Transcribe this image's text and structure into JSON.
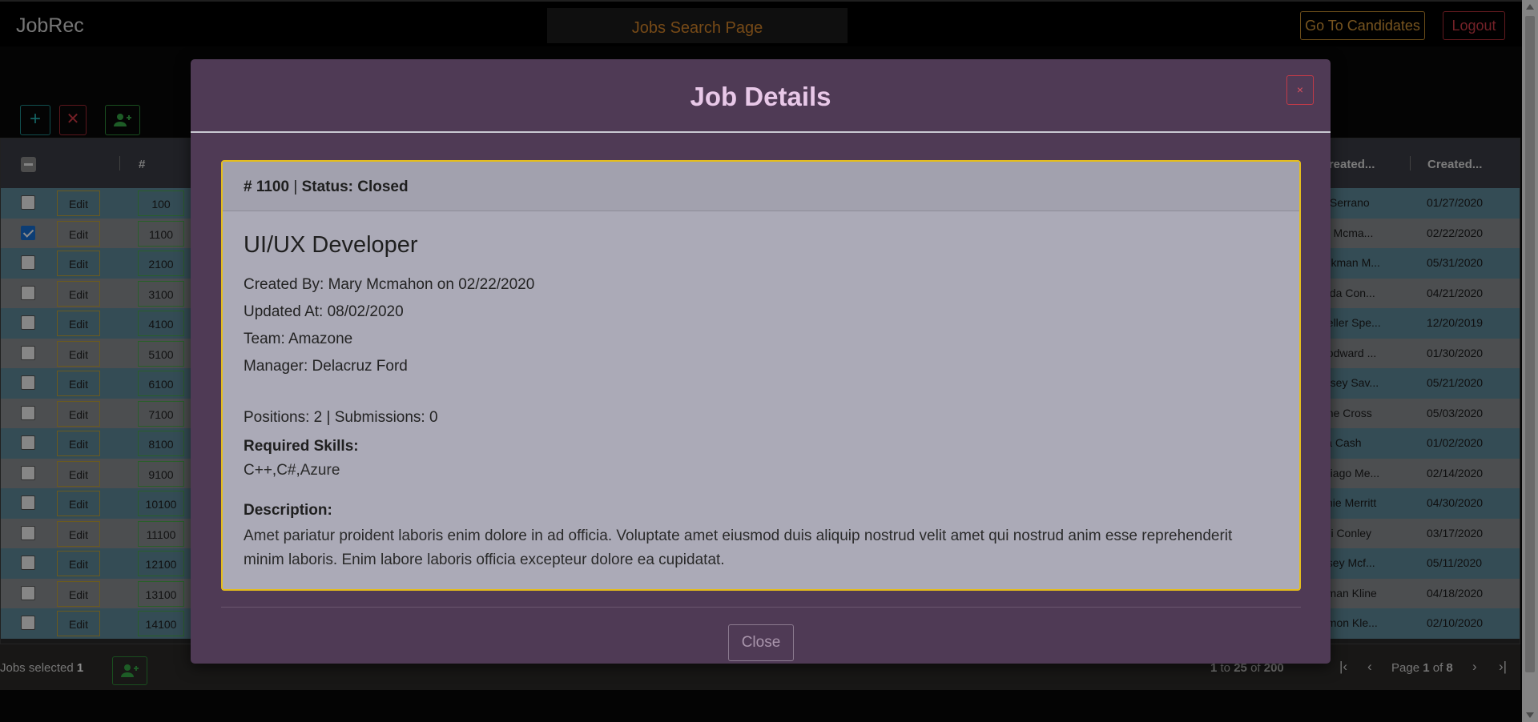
{
  "navbar": {
    "brand": "JobRec",
    "page_title": "Jobs Search Page",
    "go_to_candidates": "Go To Candidates",
    "logout": "Logout"
  },
  "toolbar": {
    "add_icon": "+",
    "delete_icon": "✕",
    "assign_icon": "person-add-icon"
  },
  "grid": {
    "headers": {
      "number": "#",
      "created_by": "Created...",
      "created_on": "Created..."
    },
    "rows": [
      {
        "checked": false,
        "edit": "Edit",
        "id": "100",
        "created_by": "s Serrano",
        "created_on": "01/27/2020"
      },
      {
        "checked": true,
        "edit": "Edit",
        "id": "1100",
        "created_by": "ry Mcma...",
        "created_on": "02/22/2020"
      },
      {
        "checked": false,
        "edit": "Edit",
        "id": "2100",
        "created_by": "orkman M...",
        "created_on": "05/31/2020"
      },
      {
        "checked": false,
        "edit": "Edit",
        "id": "3100",
        "created_by": "inda Con...",
        "created_on": "04/21/2020"
      },
      {
        "checked": false,
        "edit": "Edit",
        "id": "4100",
        "created_by": "heller Spe...",
        "created_on": "12/20/2019"
      },
      {
        "checked": false,
        "edit": "Edit",
        "id": "5100",
        "created_by": "oodward ...",
        "created_on": "01/30/2020"
      },
      {
        "checked": false,
        "edit": "Edit",
        "id": "6100",
        "created_by": "msey Sav...",
        "created_on": "05/21/2020"
      },
      {
        "checked": false,
        "edit": "Edit",
        "id": "7100",
        "created_by": "one Cross",
        "created_on": "05/03/2020"
      },
      {
        "checked": false,
        "edit": "Edit",
        "id": "8100",
        "created_by": "lia Cash",
        "created_on": "01/02/2020"
      },
      {
        "checked": false,
        "edit": "Edit",
        "id": "9100",
        "created_by": "ntiago Me...",
        "created_on": "02/14/2020"
      },
      {
        "checked": false,
        "edit": "Edit",
        "id": "10100",
        "created_by": "chie Merritt",
        "created_on": "04/30/2020"
      },
      {
        "checked": false,
        "edit": "Edit",
        "id": "11100",
        "created_by": "eri Conley",
        "created_on": "03/17/2020"
      },
      {
        "checked": false,
        "edit": "Edit",
        "id": "12100",
        "created_by": "dsey Mcf...",
        "created_on": "05/11/2020"
      },
      {
        "checked": false,
        "edit": "Edit",
        "id": "13100",
        "created_by": "ffman Kline",
        "created_on": "04/18/2020"
      },
      {
        "checked": false,
        "edit": "Edit",
        "id": "14100",
        "created_by": "omon Kle...",
        "created_on": "02/10/2020"
      }
    ]
  },
  "footer": {
    "selected_label": "Jobs selected",
    "selected_count": "1",
    "range_from": "1",
    "range_to_word": "to",
    "range_to": "25",
    "range_of_word": "of",
    "range_total": "200",
    "page_word": "Page",
    "page_current": "1",
    "page_of_word": "of",
    "page_total": "8"
  },
  "modal": {
    "title": "Job Details",
    "close_x": "×",
    "card_header_id": "# 1100",
    "card_header_sep": "|",
    "card_header_status": "Status: Closed",
    "job_title": "UI/UX Developer",
    "created_by": "Created By: Mary Mcmahon on 02/22/2020",
    "updated_at": "Updated At: 08/02/2020",
    "team": "Team: Amazone",
    "manager": "Manager: Delacruz Ford",
    "positions": "Positions: 2 | Submissions: 0",
    "skills_label": "Required Skills:",
    "skills": "C++,C#,Azure",
    "description_label": "Description:",
    "description": "Amet pariatur proident laboris enim dolore in ad officia. Voluptate amet eiusmod duis aliquip nostrud velit amet qui nostrud anim esse reprehenderit minim laboris. Enim labore laboris officia excepteur dolore ea cupidatat.",
    "close_button": "Close"
  }
}
